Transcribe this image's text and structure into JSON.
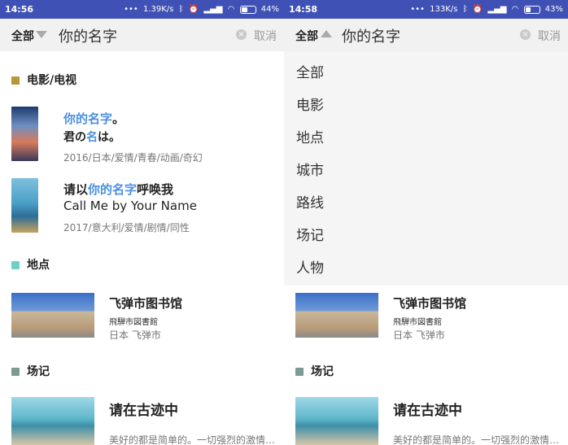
{
  "left": {
    "status": {
      "time": "14:56",
      "speed": "1.39K/s",
      "battery": "44%",
      "battery_fill": 0.44
    },
    "search": {
      "scope": "全部",
      "query": "你的名字",
      "cancel": "取消"
    },
    "sections": {
      "film": {
        "title": "电影/电视",
        "color": "#b8963a"
      },
      "place": {
        "title": "地点",
        "color": "#6fcfc9"
      },
      "scene": {
        "title": "场记",
        "color": "#7a9a93"
      }
    },
    "film1": {
      "title_hl": "你的名字",
      "title_end": "。",
      "jp_a": "君の",
      "jp_hl": "名",
      "jp_b": "は。",
      "meta": "2016/日本/爱情/青春/动画/奇幻"
    },
    "film2": {
      "pre": "请以",
      "hl": "你的名字",
      "post": "呼唤我",
      "en": "Call Me by Your Name",
      "meta": "2017/意大利/爱情/剧情/同性"
    },
    "place1": {
      "title": "飞弹市图书馆",
      "jp": "飛騨市図書館",
      "loc": "日本 飞弹市"
    },
    "scene1": {
      "title": "请在古迹中",
      "desc": "美好的都是简单的。一切强烈的激情…"
    }
  },
  "right": {
    "status": {
      "time": "14:58",
      "speed": "133K/s",
      "battery": "43%",
      "battery_fill": 0.43
    },
    "search": {
      "scope": "全部",
      "query": "你的名字",
      "cancel": "取消"
    },
    "dropdown": [
      "全部",
      "电影",
      "地点",
      "城市",
      "路线",
      "场记",
      "人物"
    ],
    "sections": {
      "scene": {
        "title": "场记",
        "color": "#7a9a93"
      }
    },
    "place1": {
      "title": "飞弹市图书馆",
      "jp": "飛騨市図書館",
      "loc": "日本 飞弹市"
    },
    "scene1": {
      "title": "请在古迹中",
      "desc": "美好的都是简单的。一切强烈的激情…"
    }
  }
}
